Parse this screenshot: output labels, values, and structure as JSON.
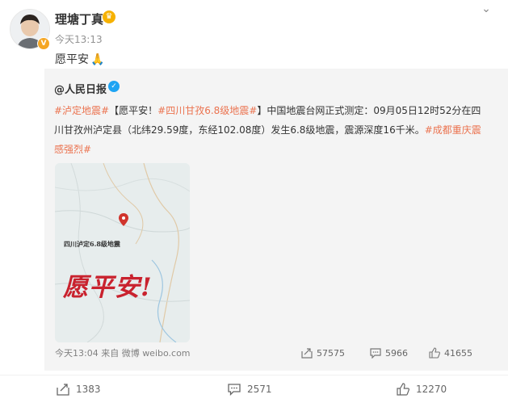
{
  "post": {
    "username": "理塘丁真",
    "time": "今天13:13",
    "text": "愿平安",
    "text_emoji": "🙏"
  },
  "repost": {
    "original_user": "@人民日报",
    "content": {
      "tag1": "#泸定地震#",
      "bracket": "【愿平安！",
      "tag2": "#四川甘孜6.8级地震#",
      "body": "】中国地震台网正式测定：09月05日12时52分在四川甘孜州泸定县（北纬29.59度，东经102.08度）发生6.8级地震，震源深度16千米。",
      "tag3": "#成都重庆震感强烈#"
    },
    "poster": {
      "location_label": "四川泸定6.8级地震",
      "title": "愿平安!"
    },
    "meta": "今天13:04 来自 微博 weibo.com",
    "stats": {
      "reposts": "57575",
      "comments": "5966",
      "likes": "41655"
    }
  },
  "actions": {
    "repost": "1383",
    "comment": "2571",
    "like": "12270"
  },
  "colors": {
    "tag": "#eb7350",
    "verified_blue": "#1ea4f3",
    "poster_red": "#c9222e"
  }
}
